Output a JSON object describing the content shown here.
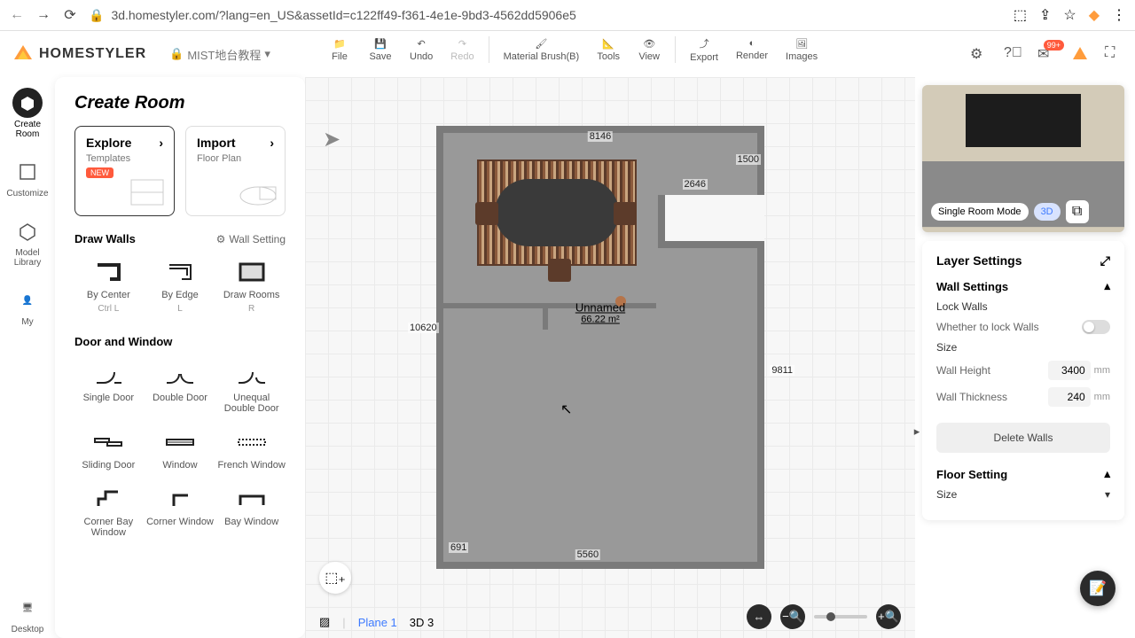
{
  "browser": {
    "url": "3d.homestyler.com/?lang=en_US&assetId=c122ff49-f361-4e1e-9bd3-4562dd5906e5"
  },
  "brand": "HOMESTYLER",
  "project_name": "MIST地台教程",
  "toolbar": {
    "file": "File",
    "save": "Save",
    "undo": "Undo",
    "redo": "Redo",
    "material_brush": "Material Brush(B)",
    "tools": "Tools",
    "view": "View",
    "export": "Export",
    "render": "Render",
    "images": "Images",
    "badge": "99+"
  },
  "rail": {
    "create_room": "Create\nRoom",
    "customize": "Customize",
    "model_library": "Model\nLibrary",
    "my": "My",
    "desktop": "Desktop"
  },
  "sidebar": {
    "title": "Create Room",
    "explore": {
      "title": "Explore",
      "sub": "Templates",
      "tag": "NEW"
    },
    "import": {
      "title": "Import",
      "sub": "Floor Plan"
    },
    "draw_walls": "Draw Walls",
    "wall_setting": "Wall Setting",
    "tools": [
      {
        "name": "By Center",
        "key": "Ctrl L"
      },
      {
        "name": "By Edge",
        "key": "L"
      },
      {
        "name": "Draw Rooms",
        "key": "R"
      }
    ],
    "door_window": "Door and Window",
    "doors": [
      "Single Door",
      "Double Door",
      "Unequal Double Door",
      "Sliding Door",
      "Window",
      "French Window",
      "Corner Bay Window",
      "Corner Window",
      "Bay Window"
    ]
  },
  "floorplan": {
    "room_name": "Unnamed",
    "room_area": "66.22 m²",
    "dims": {
      "top": "8146",
      "toprightv": "1500",
      "toprighth": "2646",
      "left": "10620",
      "right": "9811",
      "bottom": "5560",
      "bottomleft": "691"
    }
  },
  "bottom": {
    "plane": "Plane 1",
    "d3": "3D 3"
  },
  "preview": {
    "mode": "Single Room Mode",
    "d3": "3D"
  },
  "settings": {
    "title": "Layer Settings",
    "wall_settings": "Wall Settings",
    "lock_walls": "Lock Walls",
    "lock_desc": "Whether to lock Walls",
    "size": "Size",
    "wall_height": {
      "label": "Wall Height",
      "value": "3400",
      "unit": "mm"
    },
    "wall_thickness": {
      "label": "Wall Thickness",
      "value": "240",
      "unit": "mm"
    },
    "delete": "Delete Walls",
    "floor_setting": "Floor Setting",
    "size2": "Size"
  }
}
